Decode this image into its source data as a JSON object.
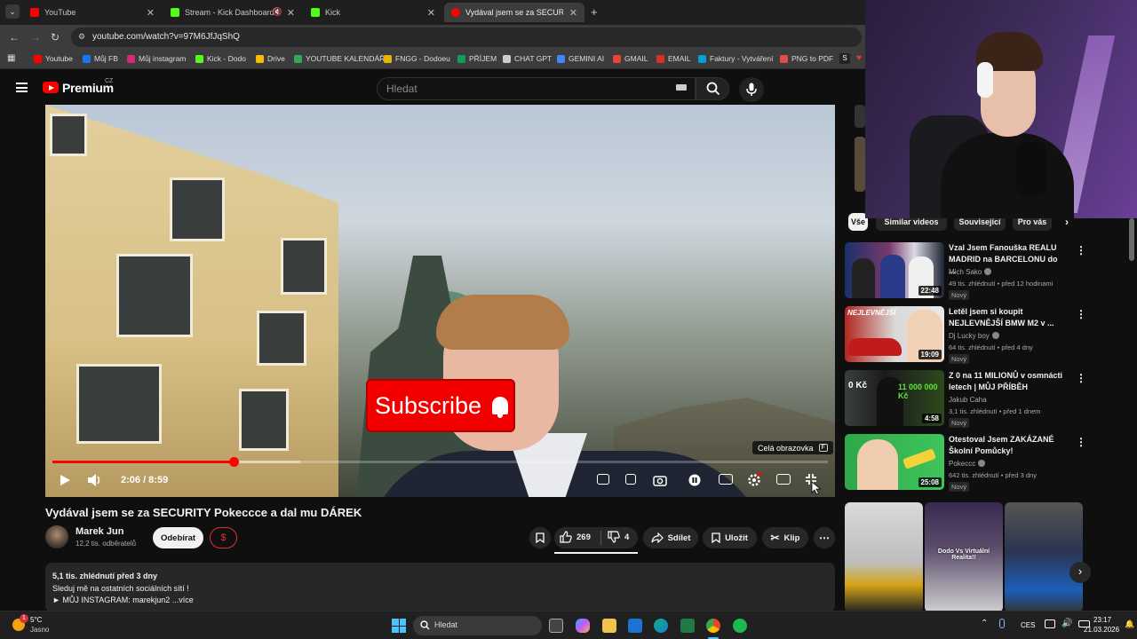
{
  "browser": {
    "tabs": [
      {
        "label": "YouTube",
        "color": "#ff0000"
      },
      {
        "label": "Stream - Kick Dashboard",
        "color": "#53fc18"
      },
      {
        "label": "Kick",
        "color": "#53fc18"
      },
      {
        "label": "Vydával jsem se za SECURITY P",
        "color": "#ff0000"
      }
    ],
    "url": "youtube.com/watch?v=97M6JfJqShQ",
    "bookmarks": [
      {
        "label": "Youtube",
        "color": "#ff0000"
      },
      {
        "label": "Můj FB",
        "color": "#1877f2"
      },
      {
        "label": "Můj instagram",
        "color": "#d62976"
      },
      {
        "label": "Kick - Dodo",
        "color": "#53fc18"
      },
      {
        "label": "Drive",
        "color": "#fbbc04"
      },
      {
        "label": "YOUTUBE KALENDÁŘ",
        "color": "#34a853"
      },
      {
        "label": "FNGG - Dodoeu",
        "color": "#e8b400"
      },
      {
        "label": "PŘÍJEM",
        "color": "#0f9d58"
      },
      {
        "label": "CHAT GPT",
        "color": "#cccccc"
      },
      {
        "label": "GEMINI AI",
        "color": "#4285f4"
      },
      {
        "label": "GMAIL",
        "color": "#ea4335"
      },
      {
        "label": "EMAIL",
        "color": "#d93025"
      },
      {
        "label": "Faktury - Vytváření",
        "color": "#00a2d4"
      },
      {
        "label": "PNG to PDF",
        "color": "#e34b4b"
      }
    ]
  },
  "header": {
    "brand": "Premium",
    "country": "CZ",
    "search_placeholder": "Hledat"
  },
  "player": {
    "overlay_text": "Subscribe",
    "fullscreen_tip": "Celá obrazovka",
    "fullscreen_key": "F",
    "time": "2:06 / 8:59",
    "progress_fraction": 0.234,
    "buffer_fraction": 0.32
  },
  "video": {
    "title": "Vydával jsem se za SECURITY Pokeccce a dal mu DÁREK",
    "channel": "Marek Jun",
    "subscribers": "12,2 tis. odběratelů",
    "subscribe_label": "Odebírat",
    "join_symbol": "$",
    "likes": "269",
    "dislikes": "4",
    "share_label": "Sdílet",
    "save_label": "Uložit",
    "clip_label": "Klip",
    "description": {
      "stats": "5,1 tis. zhlédnutí  před 3 dny",
      "line1": "Sleduj mě na ostatních sociálních sítí !",
      "line2": "► MŮJ INSTAGRAM: marekjun2 ...více"
    }
  },
  "sidebar": {
    "chips": [
      "Vše",
      "Similar videos",
      "Související",
      "Pro vás"
    ],
    "recommendations": [
      {
        "title": "Vzal Jsem Fanouška REALU MADRID na BARCELONU do ...",
        "channel": "Mich Sako",
        "meta": "49 tis. zhlédnutí • před 12 hodinami",
        "badge": "Nový",
        "duration": "22:48"
      },
      {
        "title": "Letěl jsem si koupit NEJLEVNĚJŠÍ BMW M2 v ...",
        "channel": "Dj Lucky boy",
        "meta": "64 tis. zhlédnutí • před 4 dny",
        "badge": "Nový",
        "duration": "19:09"
      },
      {
        "title": "Z 0 na 11 MILIONŮ v osmnácti letech | MŮJ PŘÍBĚH",
        "channel": "Jakub Caha",
        "meta": "3,1 tis. zhlédnutí • před 1 dnem",
        "badge": "Nový",
        "duration": "4:58"
      },
      {
        "title": "Otestoval Jsem ZAKÁZANÉ Školní Pomůcky!",
        "channel": "Pokeccc",
        "meta": "642 tis. zhlédnutí • před 3 dny",
        "badge": "Nový",
        "duration": "25:08"
      }
    ],
    "thumb_texts": [
      "NEJLEVNĚJŠÍ",
      "0 Kč",
      "11 000 000 Kč"
    ],
    "shorts_caption": "Dodo Vs Virtuální Realita!!"
  },
  "taskbar": {
    "weather_temp": "5°C",
    "weather_desc": "Jasno",
    "weather_badge": "1",
    "search_label": "Hledat",
    "lang": "CES",
    "time": "23:17",
    "date": "21.03.2026"
  }
}
